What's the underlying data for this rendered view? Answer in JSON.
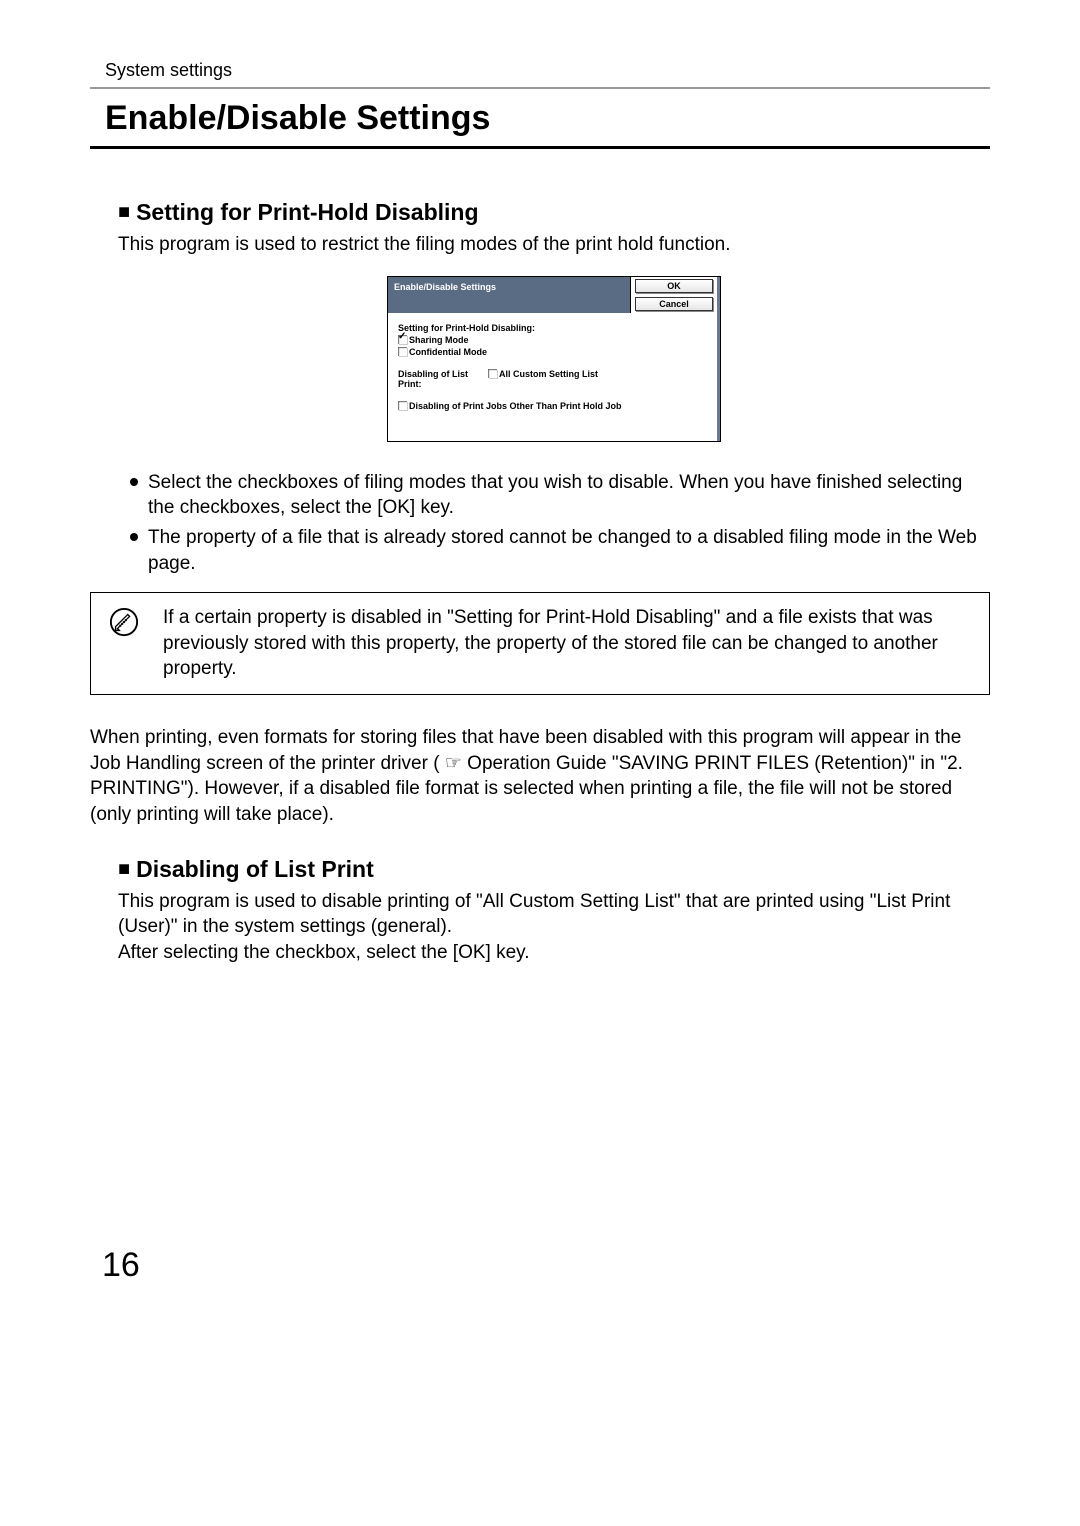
{
  "header": {
    "breadcrumb": "System settings"
  },
  "title": "Enable/Disable Settings",
  "section1": {
    "heading": "Setting for Print-Hold Disabling",
    "intro": "This program is used to restrict the filing modes of the print hold function.",
    "bullet1": "Select the checkboxes of filing modes that you wish to disable. When you have finished selecting the checkboxes, select the [OK] key.",
    "bullet2": "The property of a file that is already stored cannot be changed to a disabled filing mode in the Web page."
  },
  "diagram": {
    "title": "Enable/Disable Settings",
    "ok": "OK",
    "cancel": "Cancel",
    "group1_label": "Setting for Print-Hold Disabling:",
    "opt1": "Sharing Mode",
    "opt2": "Confidential Mode",
    "group2_left1": "Disabling of List",
    "group2_left2": "Print:",
    "group2_opt": "All Custom Setting List",
    "group3_opt": "Disabling of Print Jobs Other Than Print Hold Job"
  },
  "note": "If a certain property is disabled in \"Setting for Print-Hold Disabling\" and a file exists that was previously stored with this property, the property of the stored file can be changed to another property.",
  "para_after_note_1": "When printing, even formats for storing files that have been disabled with this program will appear in the Job Handling screen of the printer driver ( ",
  "para_after_note_2": "  Operation Guide \"SAVING PRINT FILES (Retention)\" in \"2. PRINTING\"). However, if a disabled file format is selected when printing a file, the file will not be stored (only printing will take place).",
  "section2": {
    "heading": "Disabling of List Print",
    "text": "This program is used to disable printing of \"All Custom Setting List\" that are printed using \"List Print (User)\" in the system settings (general).\nAfter selecting the checkbox, select the [OK] key."
  },
  "page_number": "16"
}
